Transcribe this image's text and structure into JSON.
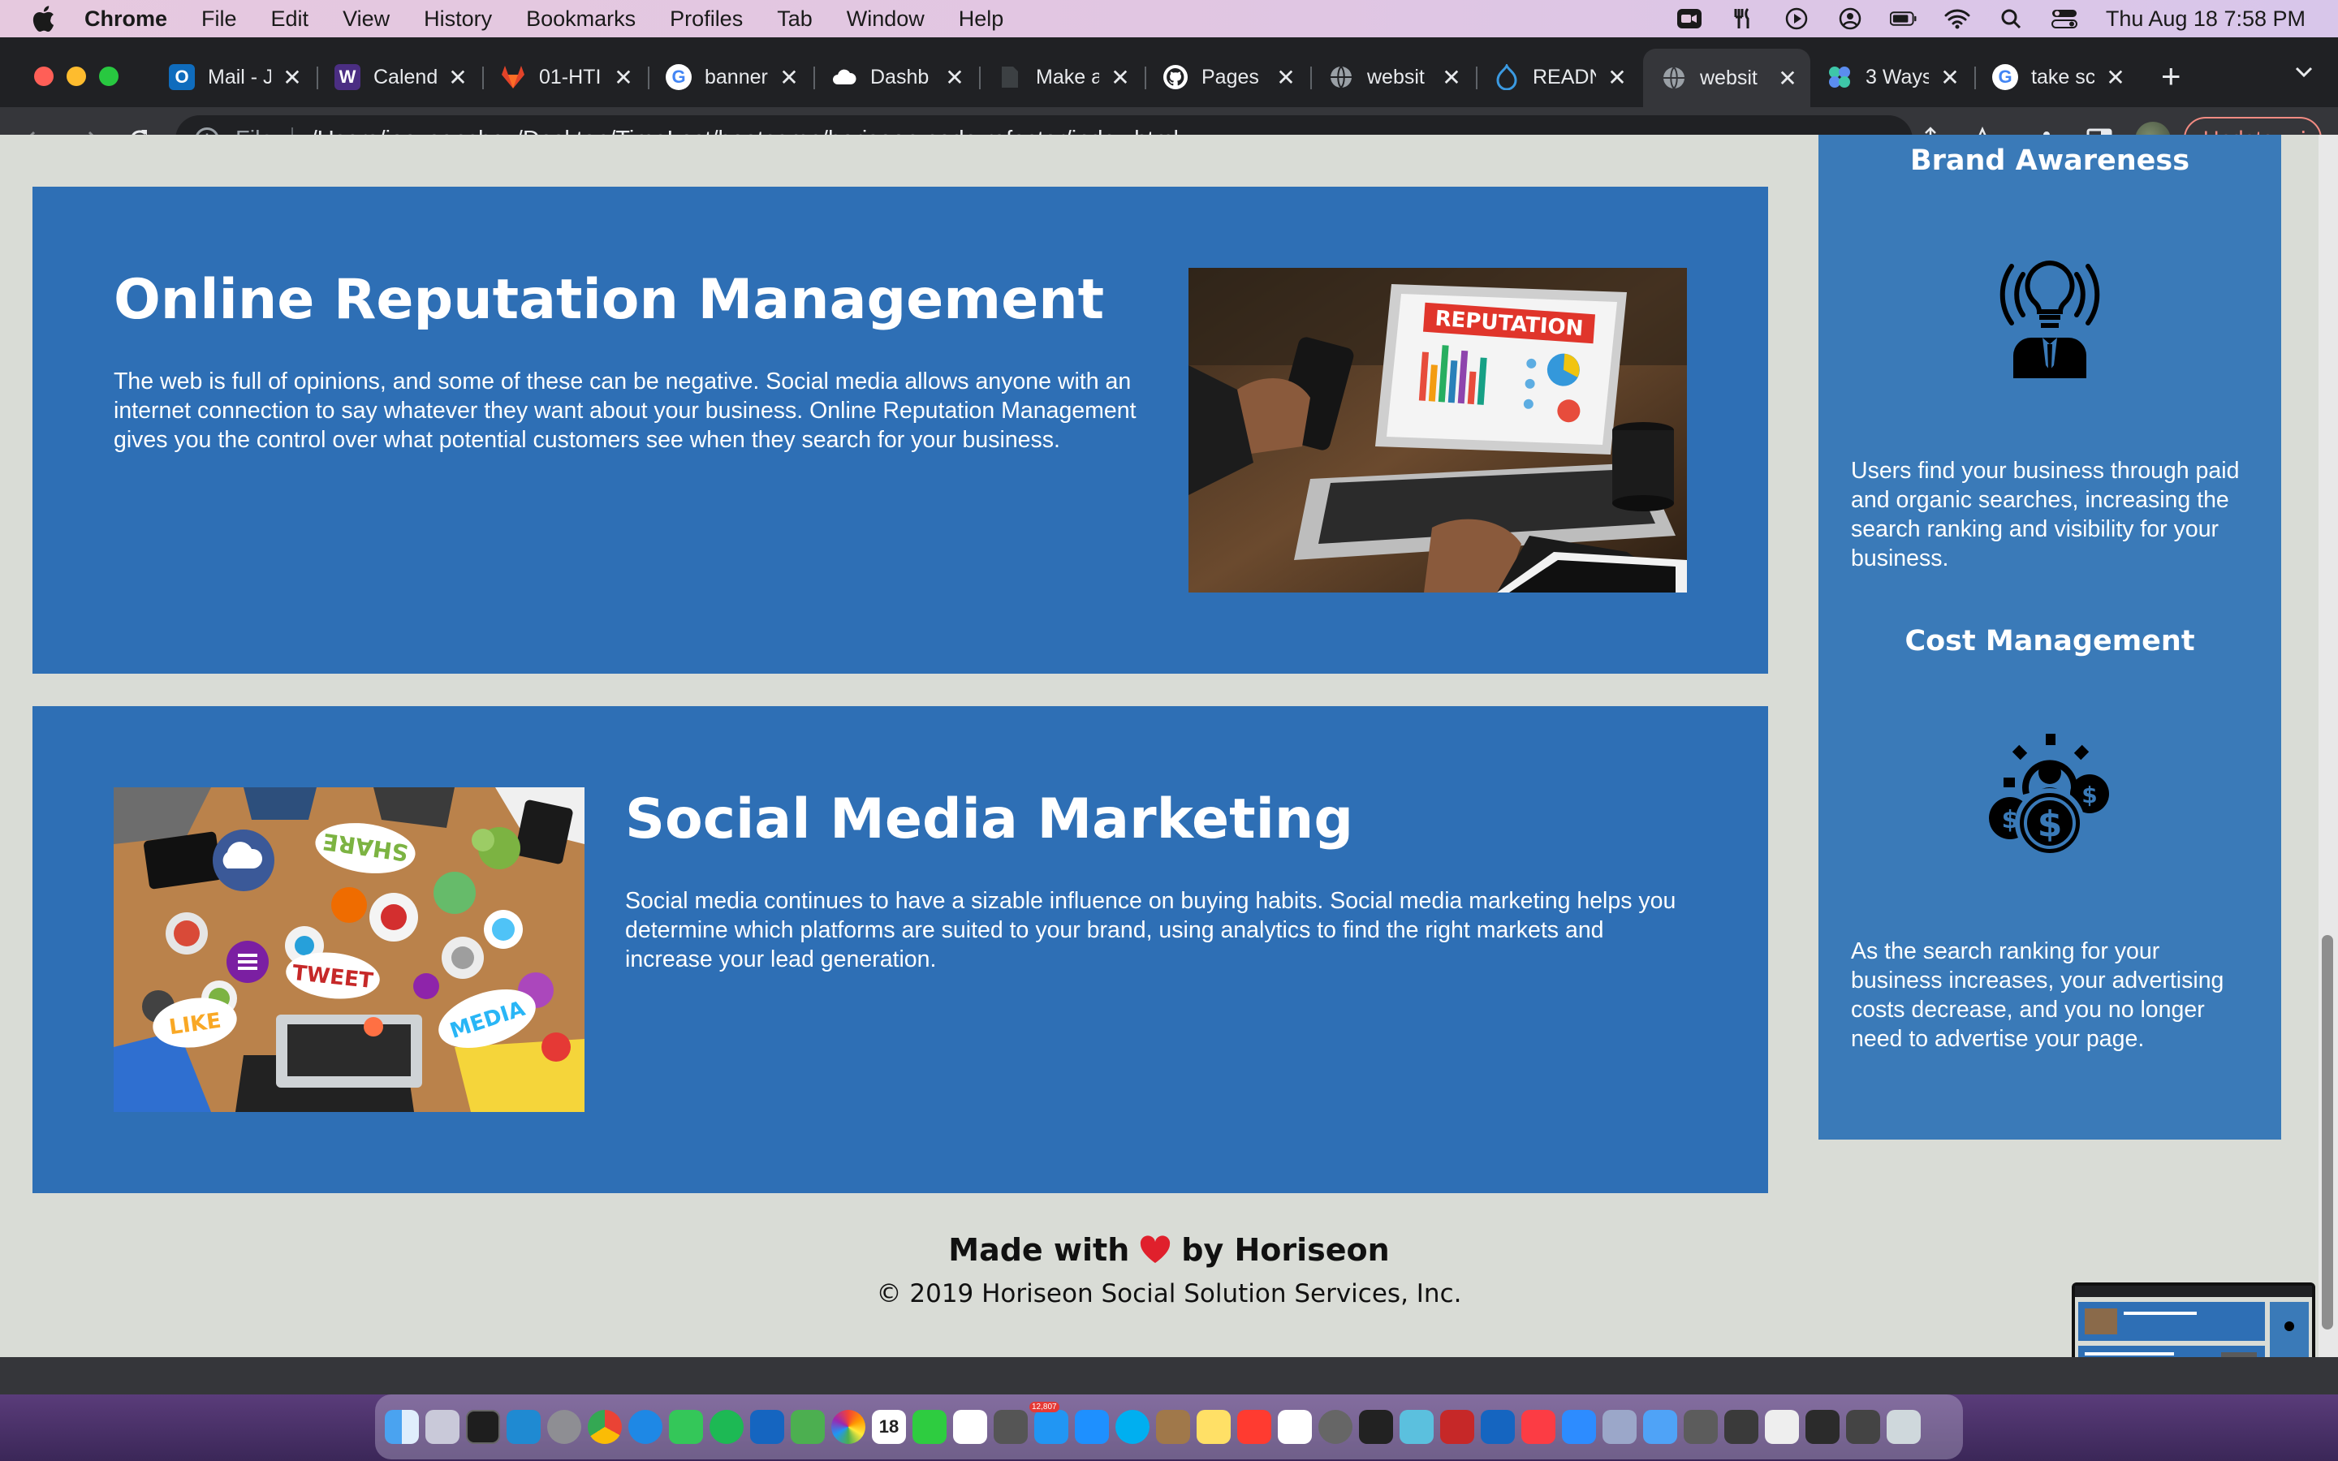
{
  "menubar": {
    "app_name": "Chrome",
    "items": [
      "File",
      "Edit",
      "View",
      "History",
      "Bookmarks",
      "Profiles",
      "Tab",
      "Window",
      "Help"
    ],
    "clock": "Thu Aug 18  7:58 PM",
    "status_icons": [
      "zoom-icon",
      "fork-icon",
      "play-icon",
      "user-circle-icon",
      "battery-icon",
      "wifi-icon",
      "search-icon",
      "control-center-icon"
    ]
  },
  "tabs": [
    {
      "label": "Mail - J",
      "icon": "outlook-icon",
      "color": "#0f6cbd"
    },
    {
      "label": "Calend",
      "icon": "w-icon",
      "color": "#4b2e83"
    },
    {
      "label": "01-HTI",
      "icon": "gitlab-icon",
      "color": "#e24329"
    },
    {
      "label": "banner",
      "icon": "google-icon",
      "color": "#ffffff"
    },
    {
      "label": "Dashb",
      "icon": "cloud-icon",
      "color": "#ffffff"
    },
    {
      "label": "Make a",
      "icon": "doc-icon",
      "color": "#5f6368"
    },
    {
      "label": "Pages",
      "icon": "github-icon",
      "color": "#ffffff"
    },
    {
      "label": "websit",
      "icon": "globe-icon",
      "color": "#9aa0a6"
    },
    {
      "label": "READN",
      "icon": "drupal-icon",
      "color": "#0678be"
    },
    {
      "label": "websit",
      "icon": "globe-icon",
      "color": "#9aa0a6",
      "active": true
    },
    {
      "label": "3 Ways",
      "icon": "flower-icon",
      "color": "#3ec6a8"
    },
    {
      "label": "take sc",
      "icon": "google-icon",
      "color": "#ffffff"
    }
  ],
  "toolbar": {
    "file_label": "File",
    "url": "/Users/joeysanchez/Desktop/TimeLost/bootcamp/horiseon-code-refactor/index.html",
    "update_label": "Update"
  },
  "page": {
    "orm": {
      "title": "Online Reputation Management",
      "body": "The web is full of opinions, and some of these can be negative. Social media allows anyone with an internet connection to say whatever they want about your business. Online Reputation Management gives you the control over what potential customers see when they search for your business.",
      "image_banner": "REPUTATION"
    },
    "smm": {
      "title": "Social Media Marketing",
      "body": "Social media continues to have a sizable influence on buying habits. Social media marketing helps you determine which platforms are suited to your brand, using analytics to find the right markets and increase your lead generation.",
      "image_words": [
        "SHARE",
        "TWEET",
        "LIKE",
        "MEDIA"
      ]
    },
    "sidebar": {
      "brand_title": "Brand Awareness",
      "brand_body": "Users find your business through paid and organic searches, increasing the search ranking and visibility for your business.",
      "cost_title": "Cost Management",
      "cost_body": "As the search ranking for your business increases, your advertising costs decrease, and you no longer need to advertise your page."
    },
    "footer": {
      "made_prefix": "Made with",
      "made_suffix": "by Horiseon",
      "copyright": "© 2019 Horiseon Social Solution Services, Inc."
    }
  },
  "colors": {
    "card_blue": "#2e6fb5",
    "sidebar_blue": "#3a7ab8",
    "page_bg": "#d9dcd6",
    "heart": "#e0202c"
  },
  "dock": {
    "badges": [
      "18",
      "12,807"
    ]
  }
}
